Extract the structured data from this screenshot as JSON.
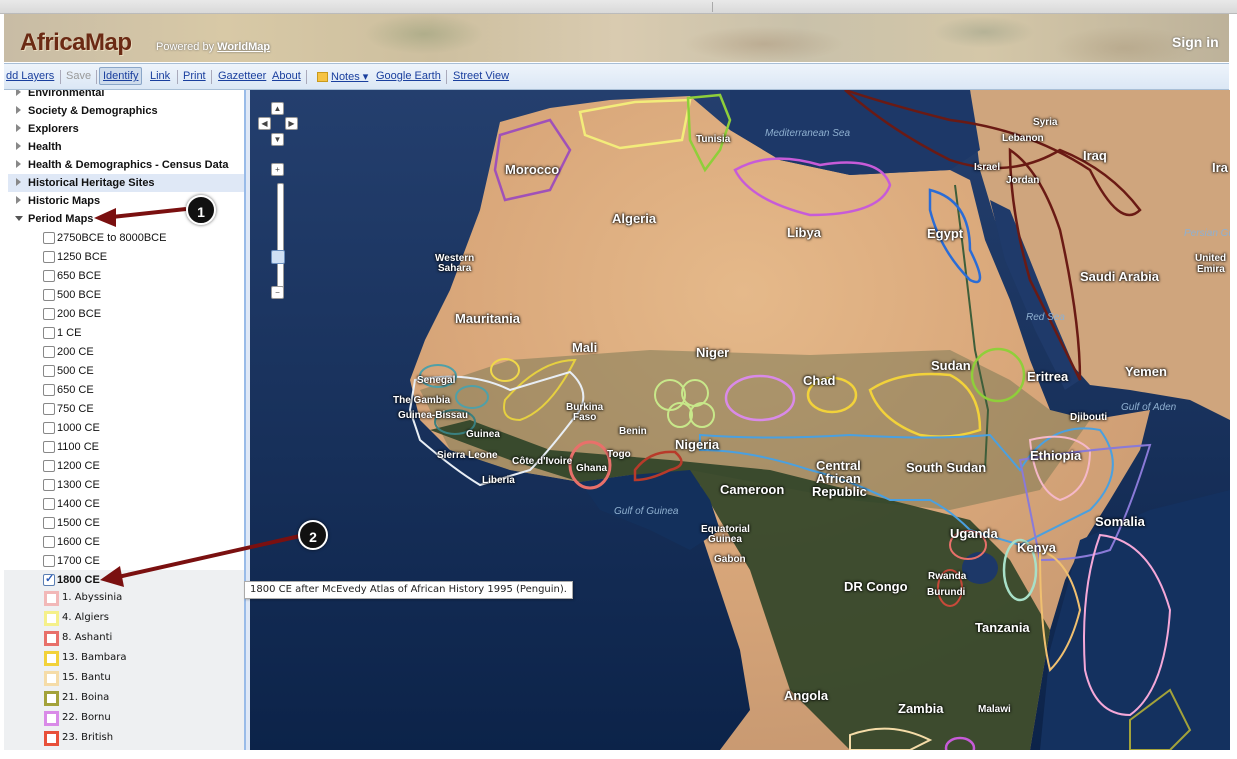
{
  "header": {
    "logo": "AfricaMap",
    "powered_prefix": "Powered by",
    "powered_link": "WorldMap",
    "sign_in": "Sign in"
  },
  "toolbar": {
    "add_layers": "dd Layers",
    "save": "Save",
    "identify": "Identify",
    "link": "Link",
    "print": "Print",
    "gazetteer": "Gazetteer",
    "about": "About",
    "notes": "Notes ▾",
    "google_earth": "Google Earth",
    "street_view": "Street View"
  },
  "sidebar": {
    "categories": [
      {
        "label": "Environmental",
        "expanded": false,
        "selected": false
      },
      {
        "label": "Society & Demographics",
        "expanded": false,
        "selected": false
      },
      {
        "label": "Explorers",
        "expanded": false,
        "selected": false
      },
      {
        "label": "Health",
        "expanded": false,
        "selected": false
      },
      {
        "label": "Health & Demographics - Census Data",
        "expanded": false,
        "selected": false
      },
      {
        "label": "Historical Heritage Sites",
        "expanded": false,
        "selected": true
      },
      {
        "label": "Historic Maps",
        "expanded": false,
        "selected": false
      },
      {
        "label": "Period Maps",
        "expanded": true,
        "selected": false
      }
    ],
    "period_layers": [
      {
        "label": "2750BCE to 8000BCE",
        "checked": false
      },
      {
        "label": "1250 BCE",
        "checked": false
      },
      {
        "label": "650 BCE",
        "checked": false
      },
      {
        "label": "500 BCE",
        "checked": false
      },
      {
        "label": "200 BCE",
        "checked": false
      },
      {
        "label": "1 CE",
        "checked": false
      },
      {
        "label": "200 CE",
        "checked": false
      },
      {
        "label": "500 CE",
        "checked": false
      },
      {
        "label": "650 CE",
        "checked": false
      },
      {
        "label": "750 CE",
        "checked": false
      },
      {
        "label": "1000 CE",
        "checked": false
      },
      {
        "label": "1100 CE",
        "checked": false
      },
      {
        "label": "1200 CE",
        "checked": false
      },
      {
        "label": "1300 CE",
        "checked": false
      },
      {
        "label": "1400 CE",
        "checked": false
      },
      {
        "label": "1500 CE",
        "checked": false
      },
      {
        "label": "1600 CE",
        "checked": false
      },
      {
        "label": "1700 CE",
        "checked": false
      },
      {
        "label": "1800 CE",
        "checked": true
      }
    ],
    "legend": [
      {
        "label": "1. Abyssinia",
        "color": "#f2b8b8"
      },
      {
        "label": "4. Algiers",
        "color": "#f5f08a"
      },
      {
        "label": "8. Ashanti",
        "color": "#e8706a"
      },
      {
        "label": "13. Bambara",
        "color": "#f2d23a"
      },
      {
        "label": "15. Bantu",
        "color": "#f5dca8"
      },
      {
        "label": "21. Boina",
        "color": "#a3a23a"
      },
      {
        "label": "22. Bornu",
        "color": "#d98ae8"
      },
      {
        "label": "23. British",
        "color": "#e8503a"
      }
    ]
  },
  "tooltip": "1800 CE after McEvedy Atlas of African History 1995 (Penguin).",
  "annotations": [
    "1",
    "2"
  ],
  "map": {
    "labels": {
      "morocco": "Morocco",
      "tunisia": "Tunisia",
      "med_sea": "Mediterranean Sea",
      "algeria": "Algeria",
      "libya": "Libya",
      "egypt": "Egypt",
      "syria": "Syria",
      "lebanon": "Lebanon",
      "israel": "Israel",
      "jordan": "Jordan",
      "iraq": "Iraq",
      "ira": "Ira",
      "saudi": "Saudi Arabia",
      "persian": "Persian Gul",
      "uae1": "United",
      "uae2": "Emira",
      "red_sea": "Red Sea",
      "western_sahara1": "Western",
      "western_sahara2": "Sahara",
      "mauritania": "Mauritania",
      "mali": "Mali",
      "niger": "Niger",
      "chad": "Chad",
      "sudan": "Sudan",
      "eritrea": "Eritrea",
      "yemen": "Yemen",
      "senegal": "Senegal",
      "gambia": "The Gambia",
      "guinea_bissau": "Guinea-Bissau",
      "guinea": "Guinea",
      "sierra_leone": "Sierra Leone",
      "liberia": "Liberia",
      "cote": "Côte d'Ivoire",
      "burkina1": "Burkina",
      "burkina2": "Faso",
      "ghana": "Ghana",
      "togo": "Togo",
      "benin": "Benin",
      "nigeria": "Nigeria",
      "djibouti": "Djibouti",
      "gulf_aden": "Gulf of Aden",
      "ethiopia": "Ethiopia",
      "south_sudan": "South Sudan",
      "car1": "Central",
      "car2": "African",
      "car3": "Republic",
      "cameroon": "Cameroon",
      "gulf_guinea": "Gulf of Guinea",
      "eq_guinea1": "Equatorial",
      "eq_guinea2": "Guinea",
      "gabon": "Gabon",
      "uganda": "Uganda",
      "kenya": "Kenya",
      "somalia": "Somalia",
      "dr_congo": "DR Congo",
      "rwanda": "Rwanda",
      "burundi": "Burundi",
      "tanzania": "Tanzania",
      "angola": "Angola",
      "zambia": "Zambia",
      "malawi": "Malawi"
    }
  }
}
